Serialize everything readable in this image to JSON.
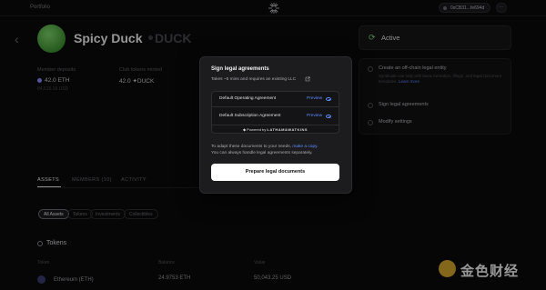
{
  "topbar": {
    "portfolio_label": "Portfolio",
    "wallet_address": "0xCB31...fe694d",
    "more_label": "···"
  },
  "club": {
    "name": "Spicy Duck",
    "symbol": "DUCK"
  },
  "stats": {
    "deposits_label": "Member deposits",
    "deposits_value": "42.0 ETH",
    "deposits_sub": "84,515.16 USD",
    "tokens_label": "Club tokens minted",
    "tokens_value": "42.0 ✦DUCK"
  },
  "tabs": [
    {
      "label": "ASSETS",
      "active": true
    },
    {
      "label": "MEMBERS (10)",
      "active": false
    },
    {
      "label": "ACTIVITY",
      "active": false
    }
  ],
  "filters": [
    {
      "label": "All Assets",
      "active": true
    },
    {
      "label": "Tokens",
      "active": false
    },
    {
      "label": "Investments",
      "active": false
    },
    {
      "label": "Collectibles",
      "active": false
    }
  ],
  "tokens": {
    "title": "Tokens",
    "headers": [
      "Token",
      "Balance",
      "Value"
    ],
    "rows": [
      {
        "token": "Ethereum (ETH)",
        "balance": "24.9753 ETH",
        "value": "50,043.25 USD"
      }
    ]
  },
  "status": {
    "label": "Active"
  },
  "setup_steps": [
    {
      "title": "Create an off-chain legal entity",
      "desc": "Syndicate can help with basic formation, filings, and legal document templates.",
      "link": "Learn more"
    },
    {
      "title": "Sign legal agreements"
    },
    {
      "title": "Modify settings"
    }
  ],
  "modal": {
    "title": "Sign legal agreements",
    "subtitle": "Takes ~5 mins and requires an existing LLC",
    "documents": [
      {
        "name": "Default Operating Agreement",
        "action": "Preview"
      },
      {
        "name": "Default Subscription Agreement",
        "action": "Preview"
      }
    ],
    "powered_prefix": "Powered by",
    "powered_brand": "LATHAM&WATKINS",
    "note_prefix": "To adapt these documents to your needs, ",
    "note_link": "make a copy",
    "note_suffix": ".",
    "note_line2": "You can always handle legal agreements separately.",
    "cta": "Prepare legal documents"
  },
  "watermark": {
    "text": "金色财经"
  },
  "colors": {
    "background": "#0b0b0c",
    "accent_link": "#5b8cff",
    "active_green": "#8ed08c",
    "cta_bg": "#ffffff"
  }
}
